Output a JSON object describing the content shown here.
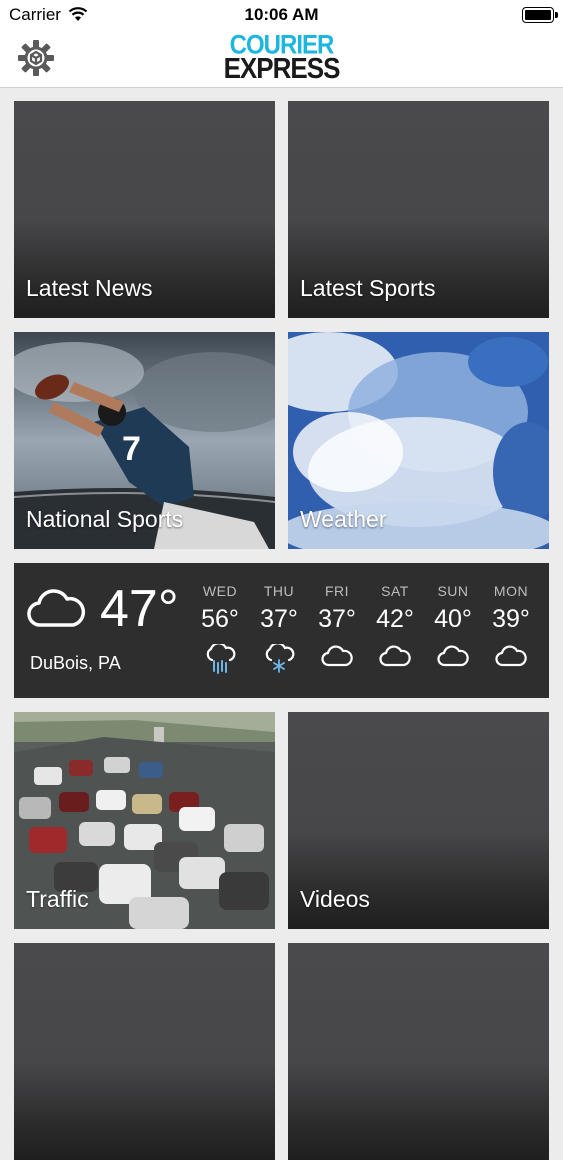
{
  "status": {
    "carrier": "Carrier",
    "time": "10:06 AM"
  },
  "header": {
    "logo_line1": "COURIER",
    "logo_line2": "EXPRESS"
  },
  "tiles": [
    {
      "label": "Latest News"
    },
    {
      "label": "Latest Sports"
    },
    {
      "label": "National Sports"
    },
    {
      "label": "Weather"
    },
    {
      "label": "Traffic"
    },
    {
      "label": "Videos"
    }
  ],
  "weather": {
    "current_temp": "47°",
    "location": "DuBois, PA",
    "current_icon": "cloud-icon",
    "forecast": [
      {
        "day": "WED",
        "temp": "56°",
        "icon": "rain-cloud-icon"
      },
      {
        "day": "THU",
        "temp": "37°",
        "icon": "snow-cloud-icon"
      },
      {
        "day": "FRI",
        "temp": "37°",
        "icon": "cloud-icon"
      },
      {
        "day": "SAT",
        "temp": "42°",
        "icon": "cloud-icon"
      },
      {
        "day": "SUN",
        "temp": "40°",
        "icon": "cloud-icon"
      },
      {
        "day": "MON",
        "temp": "39°",
        "icon": "cloud-icon"
      }
    ]
  },
  "colors": {
    "accent": "#1db6df",
    "tile_dark": "#474749",
    "weather_bg": "#2e2e2f"
  }
}
